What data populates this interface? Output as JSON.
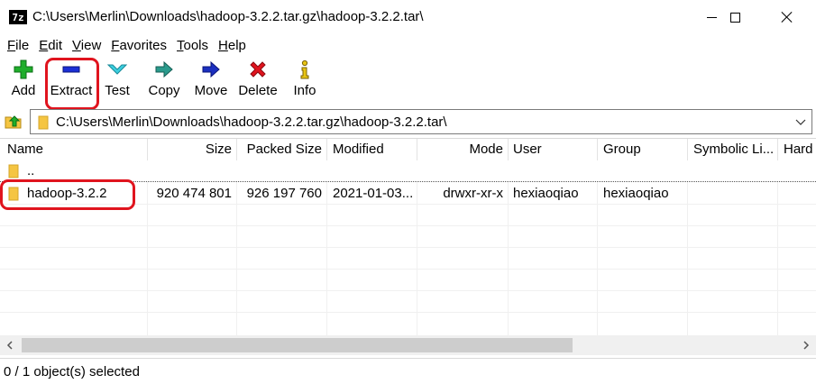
{
  "window": {
    "app_icon_text": "7z",
    "title": "C:\\Users\\Merlin\\Downloads\\hadoop-3.2.2.tar.gz\\hadoop-3.2.2.tar\\"
  },
  "menu": [
    {
      "label": "File",
      "accel": "F",
      "rest": "ile"
    },
    {
      "label": "Edit",
      "accel": "E",
      "rest": "dit"
    },
    {
      "label": "View",
      "accel": "V",
      "rest": "iew"
    },
    {
      "label": "Favorites",
      "accel": "F",
      "rest": "avorites"
    },
    {
      "label": "Tools",
      "accel": "T",
      "rest": "ools"
    },
    {
      "label": "Help",
      "accel": "H",
      "rest": "elp"
    }
  ],
  "toolbar": {
    "add": "Add",
    "extract": "Extract",
    "test": "Test",
    "copy": "Copy",
    "move": "Move",
    "delete": "Delete",
    "info": "Info"
  },
  "address": {
    "path": "C:\\Users\\Merlin\\Downloads\\hadoop-3.2.2.tar.gz\\hadoop-3.2.2.tar\\"
  },
  "columns": {
    "name": "Name",
    "size": "Size",
    "packed": "Packed Size",
    "modified": "Modified",
    "mode": "Mode",
    "user": "User",
    "group": "Group",
    "symlink": "Symbolic Li...",
    "hard": "Hard"
  },
  "rows": [
    {
      "name": "..",
      "size": "",
      "packed": "",
      "modified": "",
      "mode": "",
      "user": "",
      "group": ""
    },
    {
      "name": "hadoop-3.2.2",
      "size": "920 474 801",
      "packed": "926 197 760",
      "modified": "2021-01-03...",
      "mode": "drwxr-xr-x",
      "user": "hexiaoqiao",
      "group": "hexiaoqiao"
    }
  ],
  "status": {
    "text": "0 / 1 object(s) selected"
  },
  "colors": {
    "highlight": "#e0141e",
    "folder": "#f5c542"
  },
  "icons": [
    "app-icon",
    "add-icon",
    "extract-icon",
    "test-icon",
    "copy-icon",
    "move-icon",
    "delete-icon",
    "info-icon",
    "up-folder-icon",
    "folder-icon",
    "chevron-down-icon"
  ]
}
